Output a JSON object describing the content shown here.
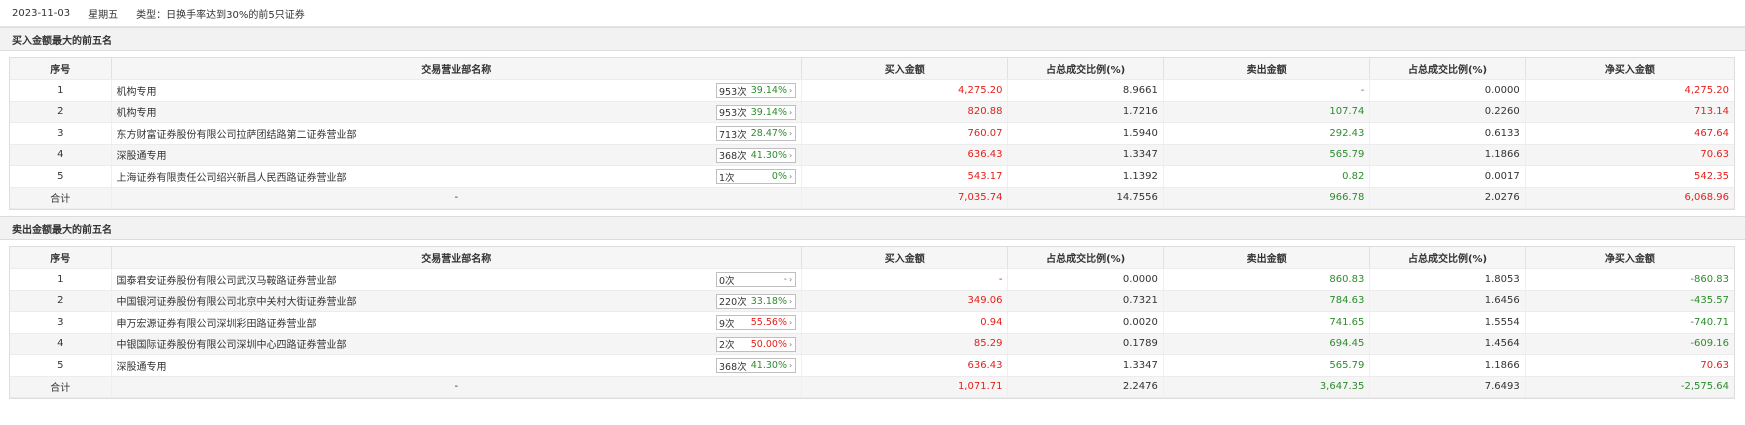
{
  "header": {
    "date": "2023-11-03",
    "weekday": "星期五",
    "type_label": "类型：",
    "type_value": "日换手率达到30%的前5只证券"
  },
  "columns": [
    "序号",
    "交易营业部名称",
    "买入金额",
    "占总成交比例(%)",
    "卖出金额",
    "占总成交比例(%)",
    "净买入金额"
  ],
  "buy_section": {
    "title": "买入金额最大的前五名",
    "rows": [
      {
        "idx": "1",
        "name": "机构专用",
        "count": "953次",
        "pct": "39.14%",
        "pct_color": "green",
        "buy": "4,275.20",
        "buy_ratio": "8.9661",
        "sell": "-",
        "sell_ratio": "0.0000",
        "net": "4,275.20",
        "net_color": "red"
      },
      {
        "idx": "2",
        "name": "机构专用",
        "count": "953次",
        "pct": "39.14%",
        "pct_color": "green",
        "buy": "820.88",
        "buy_ratio": "1.7216",
        "sell": "107.74",
        "sell_ratio": "0.2260",
        "net": "713.14",
        "net_color": "red"
      },
      {
        "idx": "3",
        "name": "东方财富证券股份有限公司拉萨团结路第二证券营业部",
        "count": "713次",
        "pct": "28.47%",
        "pct_color": "green",
        "buy": "760.07",
        "buy_ratio": "1.5940",
        "sell": "292.43",
        "sell_ratio": "0.6133",
        "net": "467.64",
        "net_color": "red"
      },
      {
        "idx": "4",
        "name": "深股通专用",
        "count": "368次",
        "pct": "41.30%",
        "pct_color": "green",
        "buy": "636.43",
        "buy_ratio": "1.3347",
        "sell": "565.79",
        "sell_ratio": "1.1866",
        "net": "70.63",
        "net_color": "red"
      },
      {
        "idx": "5",
        "name": "上海证券有限责任公司绍兴新昌人民西路证券营业部",
        "count": "1次",
        "pct": "0%",
        "pct_color": "green",
        "buy": "543.17",
        "buy_ratio": "1.1392",
        "sell": "0.82",
        "sell_ratio": "0.0017",
        "net": "542.35",
        "net_color": "red"
      }
    ],
    "total": {
      "label": "合计",
      "name": "-",
      "buy": "7,035.74",
      "buy_ratio": "14.7556",
      "sell": "966.78",
      "sell_ratio": "2.0276",
      "net": "6,068.96",
      "net_color": "red"
    }
  },
  "sell_section": {
    "title": "卖出金额最大的前五名",
    "rows": [
      {
        "idx": "1",
        "name": "国泰君安证券股份有限公司武汉马鞍路证券营业部",
        "count": "0次",
        "pct": "-",
        "pct_color": "gray",
        "buy": "-",
        "buy_ratio": "0.0000",
        "sell": "860.83",
        "sell_ratio": "1.8053",
        "net": "-860.83",
        "net_color": "green"
      },
      {
        "idx": "2",
        "name": "中国银河证券股份有限公司北京中关村大街证券营业部",
        "count": "220次",
        "pct": "33.18%",
        "pct_color": "green",
        "buy": "349.06",
        "buy_ratio": "0.7321",
        "sell": "784.63",
        "sell_ratio": "1.6456",
        "net": "-435.57",
        "net_color": "green"
      },
      {
        "idx": "3",
        "name": "申万宏源证券有限公司深圳彩田路证券营业部",
        "count": "9次",
        "pct": "55.56%",
        "pct_color": "red",
        "buy": "0.94",
        "buy_ratio": "0.0020",
        "sell": "741.65",
        "sell_ratio": "1.5554",
        "net": "-740.71",
        "net_color": "green"
      },
      {
        "idx": "4",
        "name": "中银国际证券股份有限公司深圳中心四路证券营业部",
        "count": "2次",
        "pct": "50.00%",
        "pct_color": "red",
        "buy": "85.29",
        "buy_ratio": "0.1789",
        "sell": "694.45",
        "sell_ratio": "1.4564",
        "net": "-609.16",
        "net_color": "green"
      },
      {
        "idx": "5",
        "name": "深股通专用",
        "count": "368次",
        "pct": "41.30%",
        "pct_color": "green",
        "buy": "636.43",
        "buy_ratio": "1.3347",
        "sell": "565.79",
        "sell_ratio": "1.1866",
        "net": "70.63",
        "net_color": "red"
      }
    ],
    "total": {
      "label": "合计",
      "name": "-",
      "buy": "1,071.71",
      "buy_ratio": "2.2476",
      "sell": "3,647.35",
      "sell_ratio": "7.6493",
      "net": "-2,575.64",
      "net_color": "green"
    }
  },
  "colors": {
    "red": "#e5201b",
    "green": "#2c8d2c",
    "gray": "#888888"
  },
  "icons": {
    "stat_arrow": "chevron-right-icon"
  }
}
